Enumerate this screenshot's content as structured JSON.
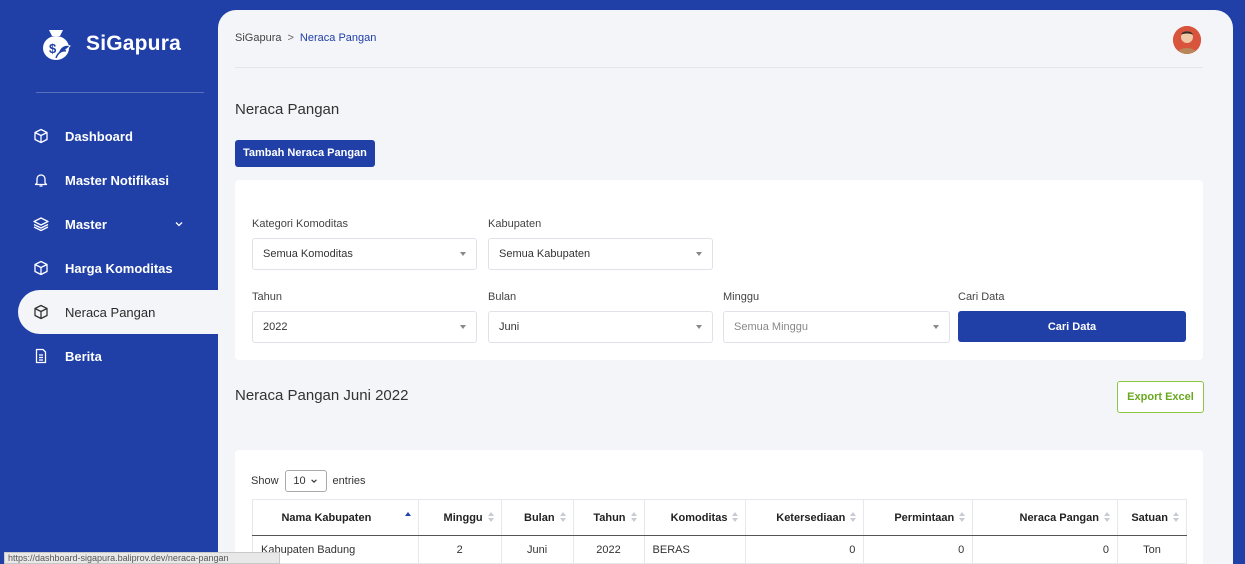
{
  "brand": {
    "name": "SiGapura"
  },
  "sidebar": {
    "items": [
      {
        "label": "Dashboard",
        "icon": "cube-icon"
      },
      {
        "label": "Master Notifikasi",
        "icon": "bell-icon"
      },
      {
        "label": "Master",
        "icon": "layers-icon"
      },
      {
        "label": "Harga Komoditas",
        "icon": "cube-icon"
      },
      {
        "label": "Neraca Pangan",
        "icon": "cube-icon",
        "active": true
      },
      {
        "label": "Berita",
        "icon": "document-icon"
      }
    ]
  },
  "breadcrumb": {
    "root": "SiGapura",
    "separator": ">",
    "current": "Neraca Pangan"
  },
  "page": {
    "title": "Neraca Pangan",
    "add_button": "Tambah Neraca Pangan"
  },
  "filters": {
    "kategori_label": "Kategori Komoditas",
    "kategori_value": "Semua Komoditas",
    "kabupaten_label": "Kabupaten",
    "kabupaten_value": "Semua Kabupaten",
    "tahun_label": "Tahun",
    "tahun_value": "2022",
    "bulan_label": "Bulan",
    "bulan_value": "Juni",
    "minggu_label": "Minggu",
    "minggu_value": "Semua Minggu",
    "cari_label": "Cari Data",
    "cari_button": "Cari Data"
  },
  "section": {
    "title": "Neraca Pangan Juni 2022",
    "export_button": "Export Excel"
  },
  "table": {
    "show_label": "Show",
    "length_value": "10",
    "entries_label": "entries",
    "columns": [
      "Nama Kabupaten",
      "Minggu",
      "Bulan",
      "Tahun",
      "Komoditas",
      "Ketersediaan",
      "Permintaan",
      "Neraca Pangan",
      "Satuan"
    ],
    "rows": [
      [
        "Kabupaten Badung",
        "2",
        "Juni",
        "2022",
        "BERAS",
        "0",
        "0",
        "0",
        "Ton"
      ]
    ]
  },
  "status_url": "https://dashboard-sigapura.baliprov.dev/neraca-pangan",
  "colors": {
    "primary": "#2040a8",
    "export": "#8dc63f",
    "background": "#f4f5f9"
  }
}
